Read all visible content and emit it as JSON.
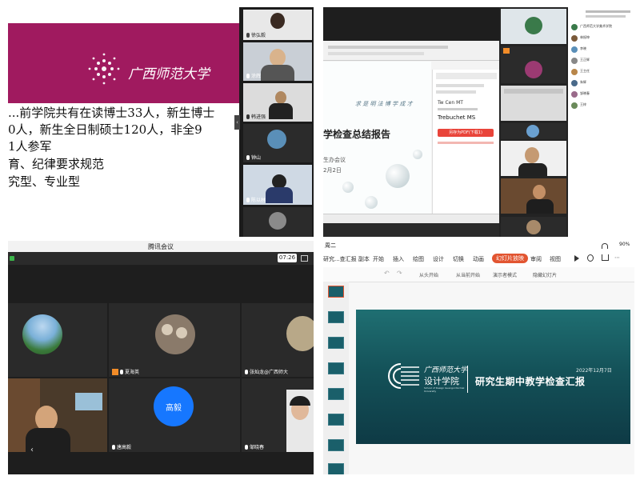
{
  "q1": {
    "logo_text": "广西师范大学",
    "lines": [
      "...前学院共有在读博士33人，新生博士",
      "0人，新生全日制硕士120人，非全9",
      "1人参军",
      "育、纪律要求规范",
      "究型、专业型"
    ],
    "participants": [
      "徐弘毅",
      "涂辉",
      "韩进强",
      "钟山",
      "陈以林",
      ""
    ],
    "colors": {
      "banner": "#a01a5f"
    }
  },
  "q2": {
    "slide_title": "学检查总结报告",
    "slide_tagline": "求 是 明 法   博 学 成 才",
    "slide_sub1": "生办会议",
    "slide_sub2": "2月2日",
    "panel_font": "Tw Cen MT",
    "panel_font2": "Trebuchet MS",
    "panel_button": "另存为PDF(下载1)",
    "participant_tag": "",
    "chat_names": [
      "广西师范大学美术学院",
      "林振坤",
      "李晓",
      "王正辉",
      "王主任",
      "朱辉",
      "邹晓春",
      "王梓"
    ]
  },
  "q3": {
    "app_title": "腾讯会议",
    "timer": "07:26",
    "participants": [
      "",
      "夏海英",
      "张灿龙@广西师大",
      "",
      "唐高毅",
      "邹晓春"
    ],
    "avatar_text": "高毅",
    "colors": {
      "avatar": "#1677ff",
      "badge": "#f28c28"
    }
  },
  "q4": {
    "status_left": "周二",
    "status_right": "90%",
    "file_name": "研究...查汇报 副本",
    "menu": [
      "开始",
      "插入",
      "绘图",
      "设计",
      "切换",
      "动画",
      "幻灯片放映",
      "审阅",
      "视图"
    ],
    "active_menu": "幻灯片放映",
    "toolbar": [
      "从头开始",
      "从当前开始",
      "演示者模式",
      "隐藏幻灯片"
    ],
    "slide": {
      "univ": "广西师范大学",
      "school": "设计学院",
      "school_en": "School of Design Guangxi Normal University",
      "date": "2022年12月7日",
      "title": "研究生期中教学检查汇报"
    },
    "colors": {
      "active_tab": "#e25531"
    }
  }
}
